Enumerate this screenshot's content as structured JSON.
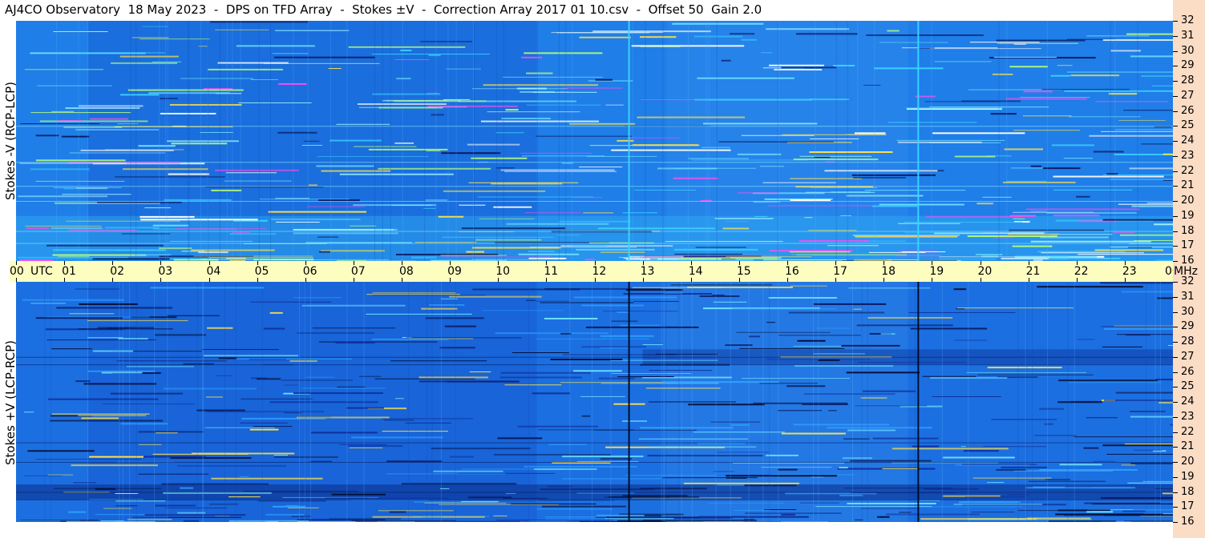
{
  "title": "AJ4CO Observatory  18 May 2023  -  DPS on TFD Array  -  Stokes ±V  -  Correction Array 2017 01 10.csv  -  Offset 50  Gain 2.0",
  "panels": {
    "top_label": "Stokes -V (RCP-LCP)",
    "bottom_label": "Stokes +V (LCP-RCP)"
  },
  "time_axis": {
    "labels": [
      "00",
      "01",
      "02",
      "03",
      "04",
      "05",
      "06",
      "07",
      "08",
      "09",
      "10",
      "11",
      "12",
      "13",
      "14",
      "15",
      "16",
      "17",
      "18",
      "19",
      "20",
      "21",
      "22",
      "23",
      "00"
    ],
    "utc_label": "UTC",
    "mhz_label": "MHz"
  },
  "freq_axis": {
    "labels": [
      "32",
      "31",
      "30",
      "29",
      "28",
      "27",
      "26",
      "25",
      "24",
      "23",
      "22",
      "21",
      "20",
      "19",
      "18",
      "17",
      "16"
    ]
  },
  "colors": {
    "background_blue": "#1e78e6",
    "timebar": "#fdfdc0",
    "freq_strip": "#fbdcc4"
  },
  "chart_data": [
    {
      "type": "heatmap",
      "title": "Stokes -V (RCP-LCP)",
      "xlabel": "UTC",
      "ylabel": "MHz",
      "xlim": [
        0,
        24
      ],
      "ylim": [
        16,
        32
      ],
      "x_ticks": [
        "00",
        "01",
        "02",
        "03",
        "04",
        "05",
        "06",
        "07",
        "08",
        "09",
        "10",
        "11",
        "12",
        "13",
        "14",
        "15",
        "16",
        "17",
        "18",
        "19",
        "20",
        "21",
        "22",
        "23",
        "00"
      ],
      "y_ticks": [
        32,
        31,
        30,
        29,
        28,
        27,
        26,
        25,
        24,
        23,
        22,
        21,
        20,
        19,
        18,
        17,
        16
      ],
      "vertical_events_utc": [
        12.7,
        18.7
      ],
      "bright_band_mhz": [
        16,
        19
      ],
      "dark_region_utc": [
        1.5,
        10.8
      ]
    },
    {
      "type": "heatmap",
      "title": "Stokes +V (LCP-RCP)",
      "xlabel": "UTC",
      "ylabel": "MHz",
      "xlim": [
        0,
        24
      ],
      "ylim": [
        16,
        32
      ],
      "x_ticks": [
        "00",
        "01",
        "02",
        "03",
        "04",
        "05",
        "06",
        "07",
        "08",
        "09",
        "10",
        "11",
        "12",
        "13",
        "14",
        "15",
        "16",
        "17",
        "18",
        "19",
        "20",
        "21",
        "22",
        "23",
        "00"
      ],
      "y_ticks": [
        32,
        31,
        30,
        29,
        28,
        27,
        26,
        25,
        24,
        23,
        22,
        21,
        20,
        19,
        18,
        17,
        16
      ],
      "vertical_events_utc": [
        12.7,
        18.7
      ],
      "dark_band_mhz": [
        17.5,
        18.5
      ],
      "dark_streak_band_mhz": [
        26.5,
        27.5
      ]
    }
  ]
}
